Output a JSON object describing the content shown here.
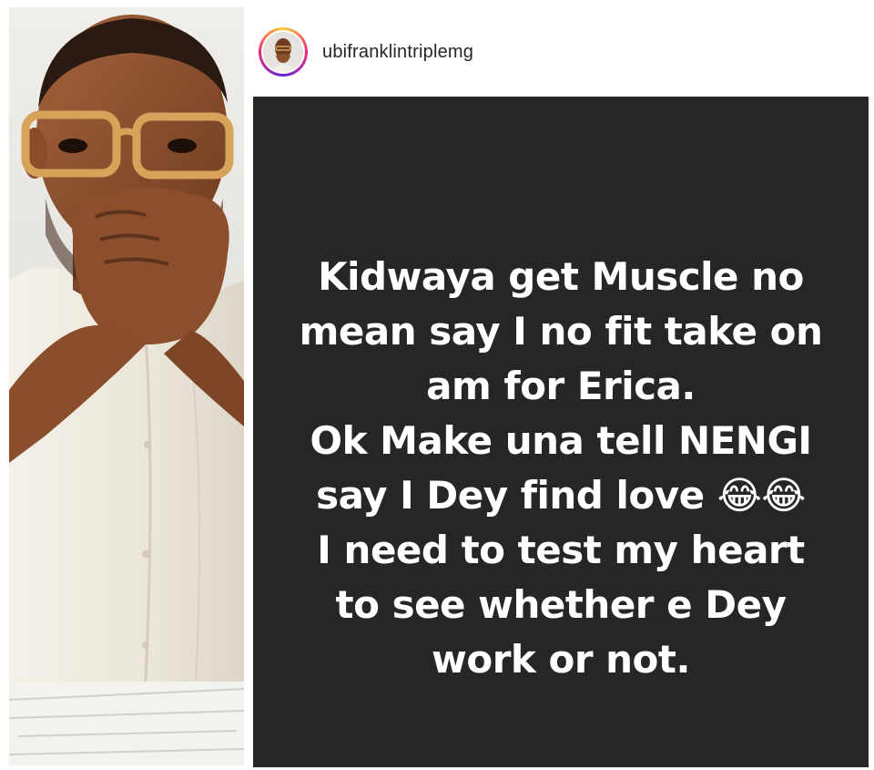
{
  "post": {
    "username": "ubifranklintriplemg"
  },
  "story": {
    "lines": [
      "Kidwaya get Muscle no",
      "mean say I no fit take on",
      "am for Erica.",
      "Ok Make una tell NENGI",
      "say I Dey find love 😂😂",
      "I need to test my heart",
      "to see whether e Dey",
      "work or not."
    ]
  },
  "colors": {
    "story_background": "#262626",
    "story_text": "#ffffff",
    "username_text": "#262626",
    "avatar_ring": "#ee2a7b"
  },
  "icons": {
    "avatar": "profile-photo",
    "emoji": "face-with-tears-of-joy"
  }
}
